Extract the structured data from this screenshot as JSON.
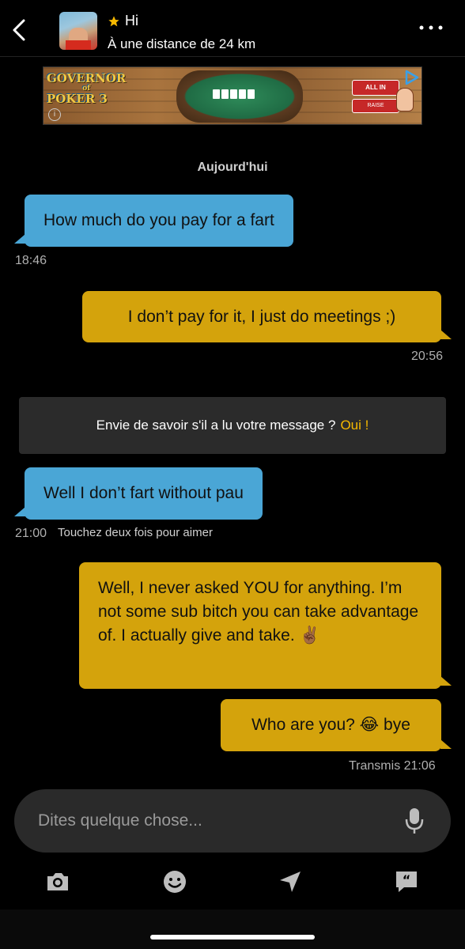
{
  "header": {
    "name": "Hi",
    "distance": "À une distance de 24 km"
  },
  "ad": {
    "logo_line1": "GOVERNOR",
    "logo_line2": "of",
    "logo_line3": "POKER 3",
    "button_allin": "ALL IN",
    "button_raise": "RAISE"
  },
  "date_separator": "Aujourd'hui",
  "messages": [
    {
      "direction": "in",
      "text": "How much do you pay for a fart",
      "time": "18:46"
    },
    {
      "direction": "out",
      "text": "I don’t pay for it, I just do meetings ;)",
      "time": "20:56"
    },
    {
      "direction": "in",
      "text": "Well I don’t fart without pau",
      "time": "21:00",
      "hint": "Touchez deux fois pour aimer"
    },
    {
      "direction": "out",
      "text": "Well, I never asked YOU for anything. I’m not some sub bitch you can take advantage of. I actually give and take. ✌🏾"
    },
    {
      "direction": "out",
      "text": "Who are you? 😂 bye",
      "time": "Transmis 21:06"
    }
  ],
  "read_prompt": {
    "text": "Envie de savoir s'il a lu votre message ?",
    "action": "Oui !"
  },
  "compose": {
    "placeholder": "Dites quelque chose..."
  },
  "toolbar": {
    "icons": [
      "camera-icon",
      "emoji-icon",
      "location-icon",
      "quick-reply-icon"
    ]
  },
  "colors": {
    "incoming_bubble": "#4aa6d6",
    "outgoing_bubble": "#d4a30c",
    "accent": "#f5b800"
  }
}
